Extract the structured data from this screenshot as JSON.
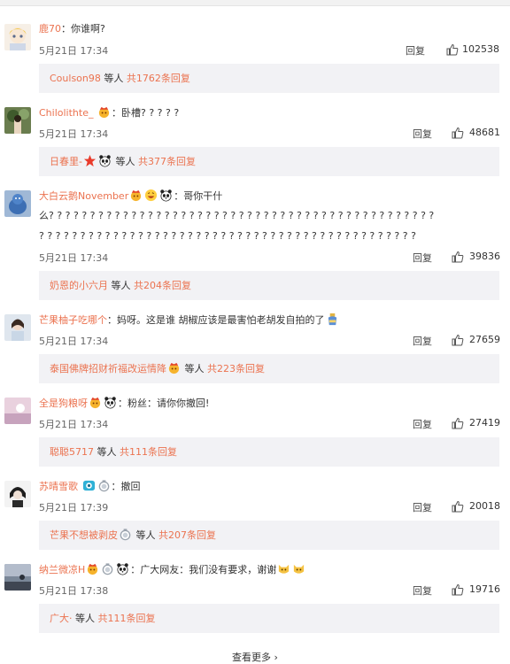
{
  "comments": [
    {
      "name": "鹿70",
      "sep": "：",
      "text": "你谁啊?",
      "text2": "",
      "date": "5月21日 17:34",
      "reply": "回复",
      "likes": "102538",
      "sub": {
        "name": "Coulson98",
        "mid": " 等人 ",
        "total": "共1762条回复"
      }
    },
    {
      "name": "Chilolithte_",
      "sep": "：",
      "text": "卧槽? ? ? ? ?",
      "text2": "",
      "date": "5月21日 17:34",
      "reply": "回复",
      "likes": "48681",
      "sub": {
        "name": "日春里-",
        "mid": " 等人 ",
        "total": "共377条回复"
      }
    },
    {
      "name": "大白云鹅November",
      "sep": "：",
      "text": "哥你干什",
      "text2": "么? ? ? ? ? ? ? ? ? ? ? ? ? ? ? ? ? ? ? ? ? ? ? ? ? ? ? ? ? ? ? ? ? ? ? ? ? ? ? ? ? ? ? ? ? ? ?",
      "text3": "? ? ? ? ? ? ? ? ? ? ? ? ? ? ? ? ? ? ? ? ? ? ? ? ? ? ? ? ? ? ? ? ? ? ? ? ? ? ? ? ? ? ? ? ? ?",
      "date": "5月21日 17:34",
      "reply": "回复",
      "likes": "39836",
      "sub": {
        "name": "奶恩的小六月",
        "mid": " 等人 ",
        "total": "共204条回复"
      }
    },
    {
      "name": "芒果柚子吃哪个",
      "sep": "：",
      "text": "妈呀。这是谁 胡椒应该是最害怕老胡发自拍的了",
      "text2": "",
      "date": "5月21日 17:34",
      "reply": "回复",
      "likes": "27659",
      "sub": {
        "name": "泰国佛牌招财祈福改运情降",
        "mid": " 等人 ",
        "total": "共223条回复"
      }
    },
    {
      "name": "全是狗粮呀",
      "sep": "：",
      "text": "粉丝：请你你撤回!",
      "text2": "",
      "date": "5月21日 17:34",
      "reply": "回复",
      "likes": "27419",
      "sub": {
        "name": "聪聪5717",
        "mid": " 等人 ",
        "total": "共111条回复"
      }
    },
    {
      "name": "苏晴雪歌",
      "sep": "：",
      "text": "撤回",
      "text2": "",
      "date": "5月21日 17:39",
      "reply": "回复",
      "likes": "20018",
      "sub": {
        "name": "芒果不想被剥皮",
        "mid": " 等人 ",
        "total": "共207条回复"
      }
    },
    {
      "name": "纳兰微凉H",
      "sep": "：",
      "text": "广大网友：我们没有要求，谢谢",
      "text2": "",
      "date": "5月21日 17:38",
      "reply": "回复",
      "likes": "19716",
      "sub": {
        "name": "广大·",
        "mid": " 等人 ",
        "total": "共111条回复"
      }
    }
  ],
  "footer": {
    "more": "查看更多 ›"
  },
  "colors": {
    "name": "#eb7350",
    "subbox": "#f2f2f5",
    "text": "#333333"
  },
  "icons": [
    "like-thumb-icon",
    "crown-badge-icon",
    "panda-emoji-icon",
    "grin-emoji-icon",
    "cat-face-emoji-icon",
    "vip-eye-icon",
    "medal-ring-icon",
    "star-icon"
  ]
}
